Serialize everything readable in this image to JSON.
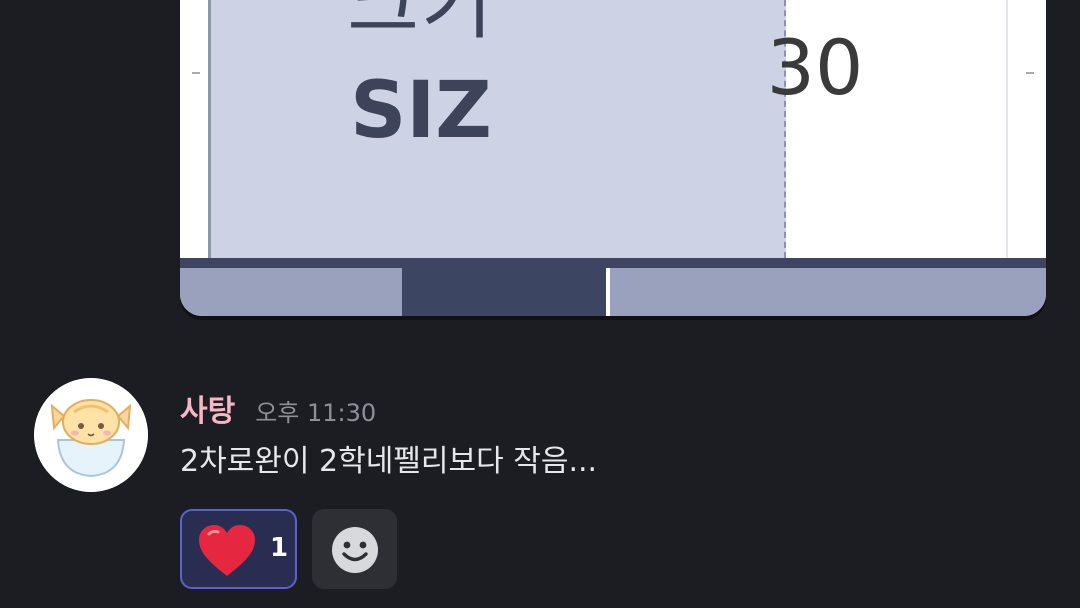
{
  "attachment": {
    "label_ko": "크기",
    "label_en": "SIZ",
    "value": "30"
  },
  "message": {
    "username": "사탕",
    "timestamp": "오후 11:30",
    "text": "2차로완이 2학네펠리보다 작음...",
    "username_color": "#f6b6c3"
  },
  "reactions": [
    {
      "icon": "heart-icon",
      "count": "1",
      "selected": true
    }
  ],
  "add_reaction": {
    "icon": "smiley-icon"
  }
}
